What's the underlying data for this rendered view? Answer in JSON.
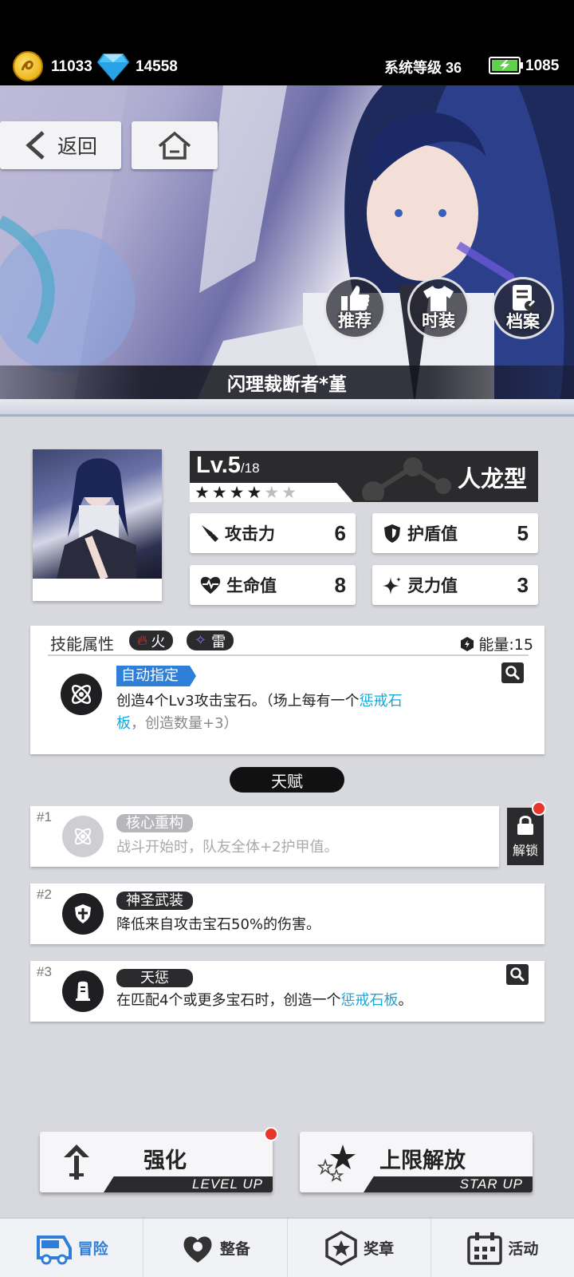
{
  "status": {
    "gold": "11033",
    "diamonds": "14558",
    "system_level": "系统等级 36",
    "energy": "1085"
  },
  "nav": {
    "back_label": "返回"
  },
  "banner_actions": [
    {
      "label": "推荐",
      "icon": "thumbs-up-icon"
    },
    {
      "label": "时装",
      "icon": "shirt-icon"
    },
    {
      "label": "档案",
      "icon": "archive-icon"
    }
  ],
  "character": {
    "name": "闪理裁断者*堇",
    "level": "Lv.5",
    "level_max": "/18",
    "stars_filled": 4,
    "stars_total": 6,
    "type": "人龙型",
    "stats": [
      {
        "label": "攻击力",
        "value": "6",
        "icon": "attack-icon"
      },
      {
        "label": "护盾值",
        "value": "5",
        "icon": "shield-icon"
      },
      {
        "label": "生命值",
        "value": "8",
        "icon": "heart-icon"
      },
      {
        "label": "灵力值",
        "value": "3",
        "icon": "sparkle-icon"
      }
    ]
  },
  "skill": {
    "attr_label": "技能属性",
    "elements": [
      {
        "label": "火",
        "icon": "fire-icon",
        "color": "#e8372a"
      },
      {
        "label": "雷",
        "icon": "lightning-icon",
        "color": "#8a6fd6"
      }
    ],
    "energy": "能量:15",
    "tag": "自动指定",
    "desc_1": "创造4个Lv3攻击宝石。（场上每有一个",
    "desc_hl": "惩戒石板",
    "desc_2": "，创造数量+3）"
  },
  "talent_header": "天赋",
  "talents": [
    {
      "num": "#1",
      "name": "核心重构",
      "desc": "战斗开始时，队友全体+2护甲值。",
      "locked": true
    },
    {
      "num": "#2",
      "name": "神圣武装",
      "desc": "降低来自攻击宝石50%的伤害。"
    },
    {
      "num": "#3",
      "name": "天惩",
      "desc_1": "在匹配4个或更多宝石时，创造一个",
      "desc_hl": "惩戒石板",
      "desc_2": "。"
    }
  ],
  "unlock_label": "解锁",
  "buttons": {
    "enhance": {
      "label": "强化",
      "sub": "LEVEL UP"
    },
    "limit": {
      "label": "上限解放",
      "sub": "STAR UP"
    }
  },
  "tabs": [
    {
      "label": "冒险",
      "icon": "vehicle-icon",
      "active": true
    },
    {
      "label": "整备",
      "icon": "heart-gear-icon"
    },
    {
      "label": "奖章",
      "icon": "medal-icon"
    },
    {
      "label": "活动",
      "icon": "calendar-icon"
    }
  ],
  "colors": {
    "accent": "#2f7fd8",
    "highlight": "#19a7d6",
    "badge": "#e8372a",
    "dark": "#2b2b2e"
  }
}
